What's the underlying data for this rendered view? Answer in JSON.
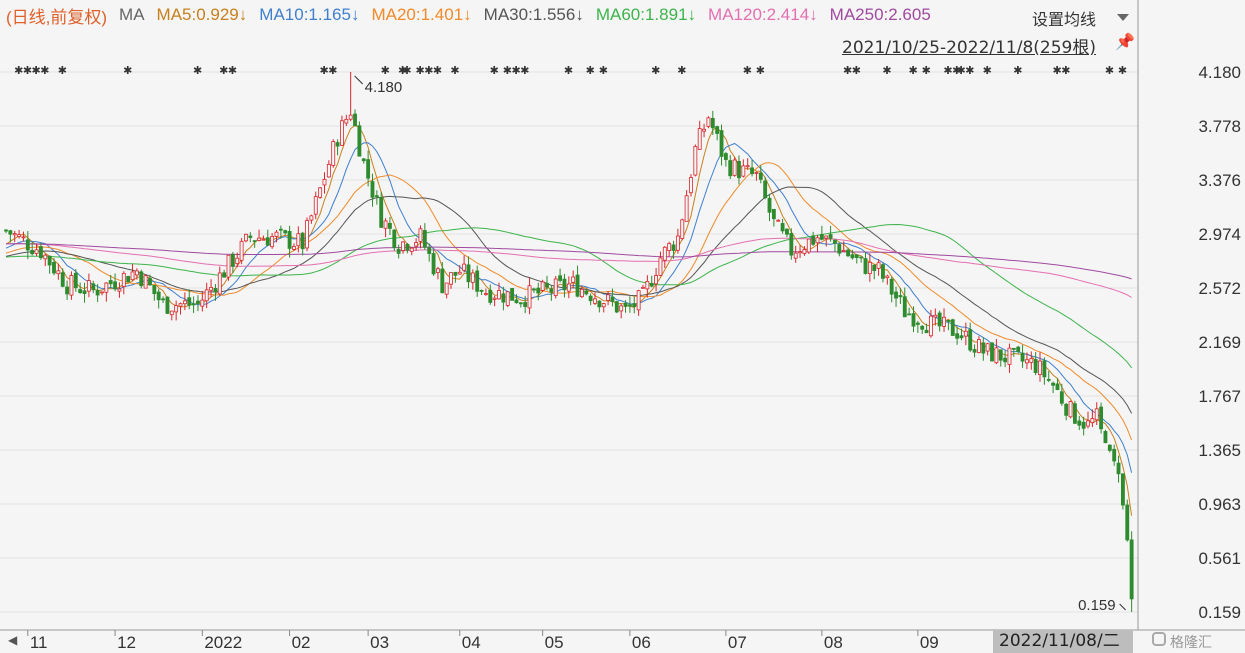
{
  "header": {
    "indicator_prefix": "(日线,前复权)",
    "ma_label": "MA",
    "ma_items": [
      {
        "text": "MA5:0.929↓",
        "color": "#c8801e"
      },
      {
        "text": "MA10:1.165↓",
        "color": "#3f7fcf"
      },
      {
        "text": "MA20:1.401↓",
        "color": "#f08a2a"
      },
      {
        "text": "MA30:1.556↓",
        "color": "#555555"
      },
      {
        "text": "MA60:1.891↓",
        "color": "#3cb44b"
      },
      {
        "text": "MA120:2.414↓",
        "color": "#e46fb0"
      },
      {
        "text": "MA250:2.605",
        "color": "#a04aa0"
      }
    ],
    "settings_label": "设置均线",
    "date_range": "2021/10/25-2022/11/8(259根)"
  },
  "chart_data": {
    "type": "candlestick",
    "y_ticks": [
      "4.180",
      "3.778",
      "3.376",
      "2.974",
      "2.572",
      "2.169",
      "1.767",
      "1.365",
      "0.963",
      "0.561",
      "0.159"
    ],
    "ylim": [
      0.159,
      4.18
    ],
    "x_tick_labels": [
      "11",
      "12",
      "2022",
      "02",
      "03",
      "04",
      "05",
      "06",
      "07",
      "08",
      "09"
    ],
    "high_annotation": "4.180",
    "low_annotation": "0.159",
    "up_color": "#d9262c",
    "down_color": "#2e8b2e",
    "monthly_closes": [
      {
        "month": "2021-11",
        "close": 2.55
      },
      {
        "month": "2021-12",
        "close": 2.45
      },
      {
        "month": "2022-01",
        "close": 2.95
      },
      {
        "month": "2022-02",
        "close": 3.7
      },
      {
        "month": "2022-03",
        "close": 2.9
      },
      {
        "month": "2022-04",
        "close": 2.5
      },
      {
        "month": "2022-05",
        "close": 2.55
      },
      {
        "month": "2022-06",
        "close": 3.8
      },
      {
        "month": "2022-07",
        "close": 2.75
      },
      {
        "month": "2022-08",
        "close": 2.2
      },
      {
        "month": "2022-09",
        "close": 2.0
      },
      {
        "month": "2022-10",
        "close": 1.4
      },
      {
        "month": "2022-11",
        "close": 0.25
      }
    ],
    "marker_symbol": "✱"
  },
  "footer": {
    "current_date": "2022/11/08/二",
    "watermark": "格隆汇"
  }
}
